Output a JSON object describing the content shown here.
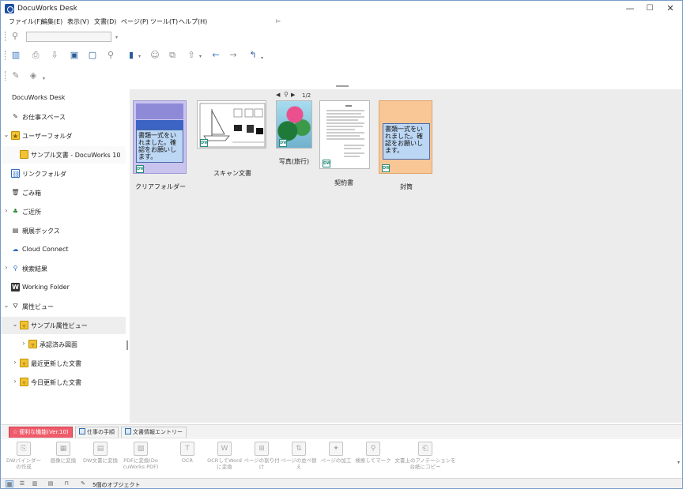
{
  "window": {
    "title": "DocuWorks Desk",
    "controls": {
      "minimize": "—",
      "maximize": "☐",
      "close": "✕"
    }
  },
  "menu": {
    "items": [
      "ファイル(F)",
      "編集(E)",
      "表示(V)",
      "文書(D)",
      "ページ(P)",
      "ツール(T)",
      "ヘルプ(H)"
    ],
    "pin": "⊨"
  },
  "toolbar": {
    "search_placeholder": ""
  },
  "sidebar": {
    "items": [
      {
        "label": "DocuWorks Desk"
      },
      {
        "label": "お仕事スペース"
      },
      {
        "label": "ユーザーフォルダ"
      },
      {
        "label": "サンプル文書 - DocuWorks 10"
      },
      {
        "label": "リンクフォルダ"
      },
      {
        "label": "ごみ箱"
      },
      {
        "label": "ご近所"
      },
      {
        "label": "親展ボックス"
      },
      {
        "label": "Cloud Connect"
      },
      {
        "label": "検索結果"
      },
      {
        "label": "Working Folder"
      },
      {
        "label": "属性ビュー"
      },
      {
        "label": "サンプル属性ビュー"
      },
      {
        "label": "承認済み図面"
      },
      {
        "label": "最近更新した文書"
      },
      {
        "label": "今日更新した文書"
      }
    ]
  },
  "documents": [
    {
      "label": "クリアフォルダー",
      "text": "書類一式をいれました。確認をお願いします。"
    },
    {
      "label": "スキャン文書"
    },
    {
      "label": "写真(旅行)"
    },
    {
      "label": "契約書"
    },
    {
      "label": "封筒",
      "text": "書類一式をいれました。確認をお願いします。"
    }
  ],
  "pager": "1/2",
  "task_tabs": [
    "便利な機能(Ver.10)",
    "仕事の手順",
    "文書情報エントリー"
  ],
  "task_buttons": [
    "DWバインダーの作成",
    "画像に変換",
    "DW文書に変換",
    "PDFに変換(DocuWorks PDF)",
    "OCR",
    "OCRしてWordに変換",
    "ページの割り付け",
    "ページの並べ替え",
    "ページの加工",
    "検索してマーク",
    "文書上のアノテーションを台紙にコピー"
  ],
  "status": {
    "text": "5個のオブジェクト"
  },
  "colors": {
    "active_tab": "#ef5b6a",
    "folder": "#f1c232",
    "content_bg": "#ececec"
  }
}
